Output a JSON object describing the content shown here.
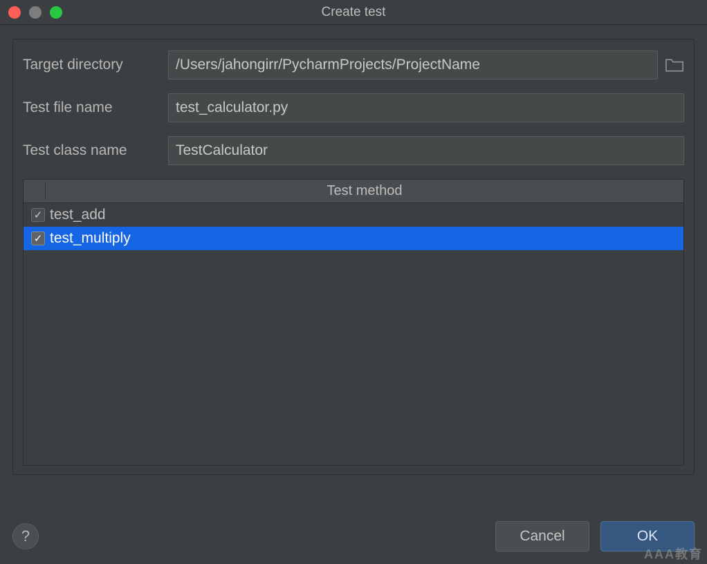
{
  "window": {
    "title": "Create test"
  },
  "form": {
    "target_directory_label": "Target directory",
    "target_directory_value": "/Users/jahongirr/PycharmProjects/ProjectName",
    "test_file_name_label": "Test file name",
    "test_file_name_value": "test_calculator.py",
    "test_class_name_label": "Test class name",
    "test_class_name_value": "TestCalculator"
  },
  "table": {
    "header": "Test method",
    "rows": [
      {
        "name": "test_add",
        "checked": true,
        "selected": false
      },
      {
        "name": "test_multiply",
        "checked": true,
        "selected": true
      }
    ]
  },
  "buttons": {
    "help": "?",
    "cancel": "Cancel",
    "ok": "OK"
  },
  "watermark": "AAA教育"
}
